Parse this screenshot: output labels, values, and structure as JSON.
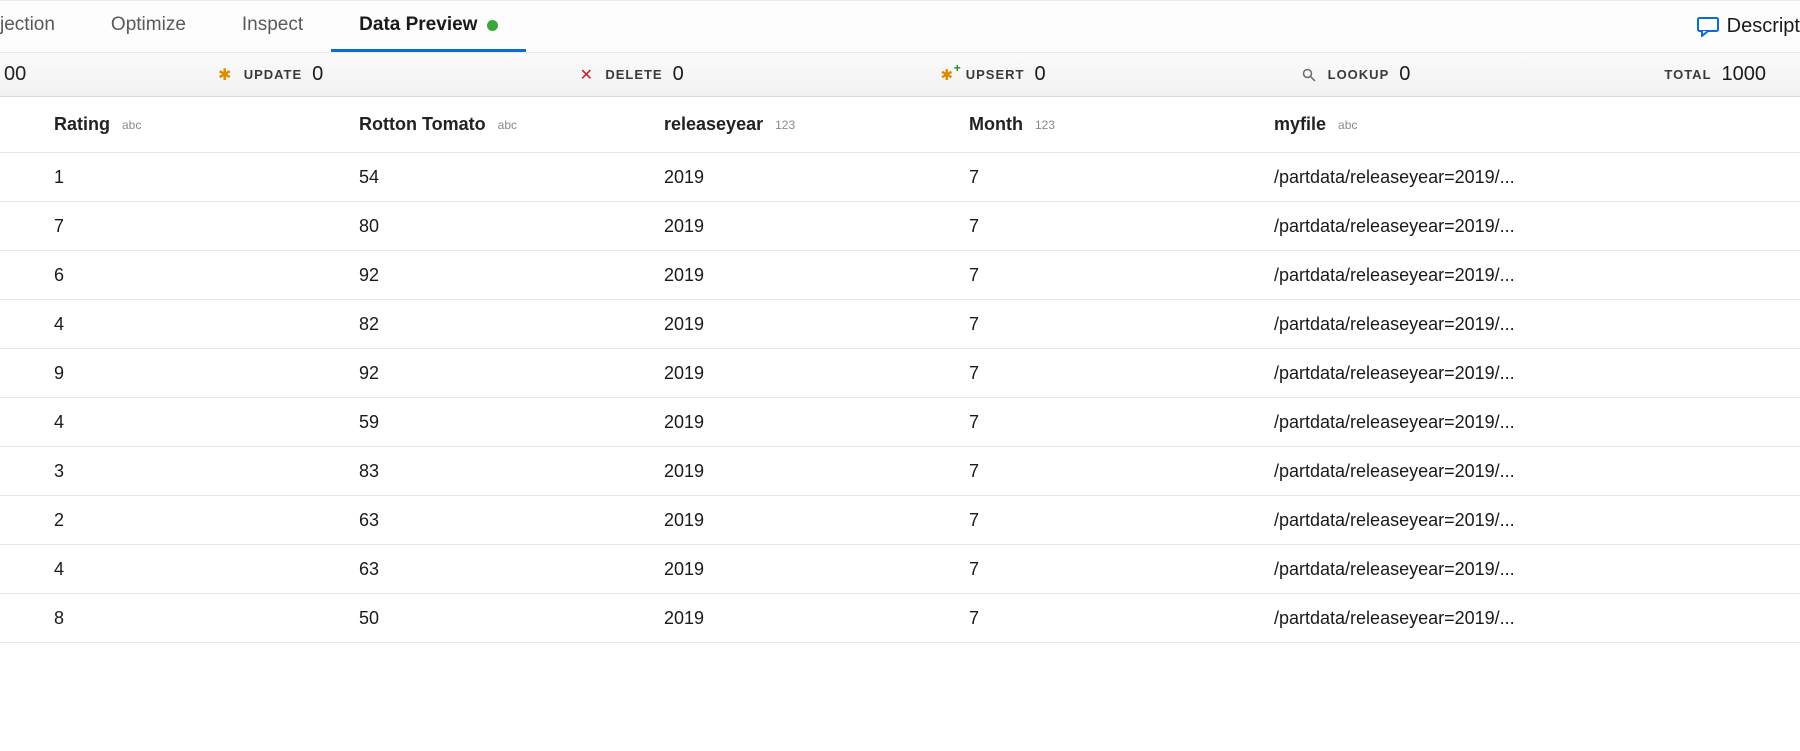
{
  "tabs": {
    "items": [
      {
        "label": "jection",
        "left_cut": true
      },
      {
        "label": "Optimize"
      },
      {
        "label": "Inspect"
      },
      {
        "label": "Data Preview",
        "active": true,
        "dot": true
      }
    ],
    "descript": {
      "label": "Descript"
    }
  },
  "stats": {
    "left_edge_value": "00",
    "update": {
      "label": "UPDATE",
      "value": "0"
    },
    "delete": {
      "label": "DELETE",
      "value": "0"
    },
    "upsert": {
      "label": "UPSERT",
      "value": "0"
    },
    "lookup": {
      "label": "LOOKUP",
      "value": "0"
    },
    "total": {
      "label": "TOTAL",
      "value": "1000"
    }
  },
  "table": {
    "columns": [
      {
        "name": "Rating",
        "type": "abc"
      },
      {
        "name": "Rotton Tomato",
        "type": "abc"
      },
      {
        "name": "releaseyear",
        "type": "123"
      },
      {
        "name": "Month",
        "type": "123"
      },
      {
        "name": "myfile",
        "type": "abc"
      }
    ],
    "rows": [
      {
        "Rating": "1",
        "Rotton Tomato": "54",
        "releaseyear": "2019",
        "Month": "7",
        "myfile": "/partdata/releaseyear=2019/..."
      },
      {
        "Rating": "7",
        "Rotton Tomato": "80",
        "releaseyear": "2019",
        "Month": "7",
        "myfile": "/partdata/releaseyear=2019/..."
      },
      {
        "Rating": "6",
        "Rotton Tomato": "92",
        "releaseyear": "2019",
        "Month": "7",
        "myfile": "/partdata/releaseyear=2019/..."
      },
      {
        "Rating": "4",
        "Rotton Tomato": "82",
        "releaseyear": "2019",
        "Month": "7",
        "myfile": "/partdata/releaseyear=2019/..."
      },
      {
        "Rating": "9",
        "Rotton Tomato": "92",
        "releaseyear": "2019",
        "Month": "7",
        "myfile": "/partdata/releaseyear=2019/..."
      },
      {
        "Rating": "4",
        "Rotton Tomato": "59",
        "releaseyear": "2019",
        "Month": "7",
        "myfile": "/partdata/releaseyear=2019/..."
      },
      {
        "Rating": "3",
        "Rotton Tomato": "83",
        "releaseyear": "2019",
        "Month": "7",
        "myfile": "/partdata/releaseyear=2019/..."
      },
      {
        "Rating": "2",
        "Rotton Tomato": "63",
        "releaseyear": "2019",
        "Month": "7",
        "myfile": "/partdata/releaseyear=2019/..."
      },
      {
        "Rating": "4",
        "Rotton Tomato": "63",
        "releaseyear": "2019",
        "Month": "7",
        "myfile": "/partdata/releaseyear=2019/..."
      },
      {
        "Rating": "8",
        "Rotton Tomato": "50",
        "releaseyear": "2019",
        "Month": "7",
        "myfile": "/partdata/releaseyear=2019/..."
      }
    ]
  }
}
